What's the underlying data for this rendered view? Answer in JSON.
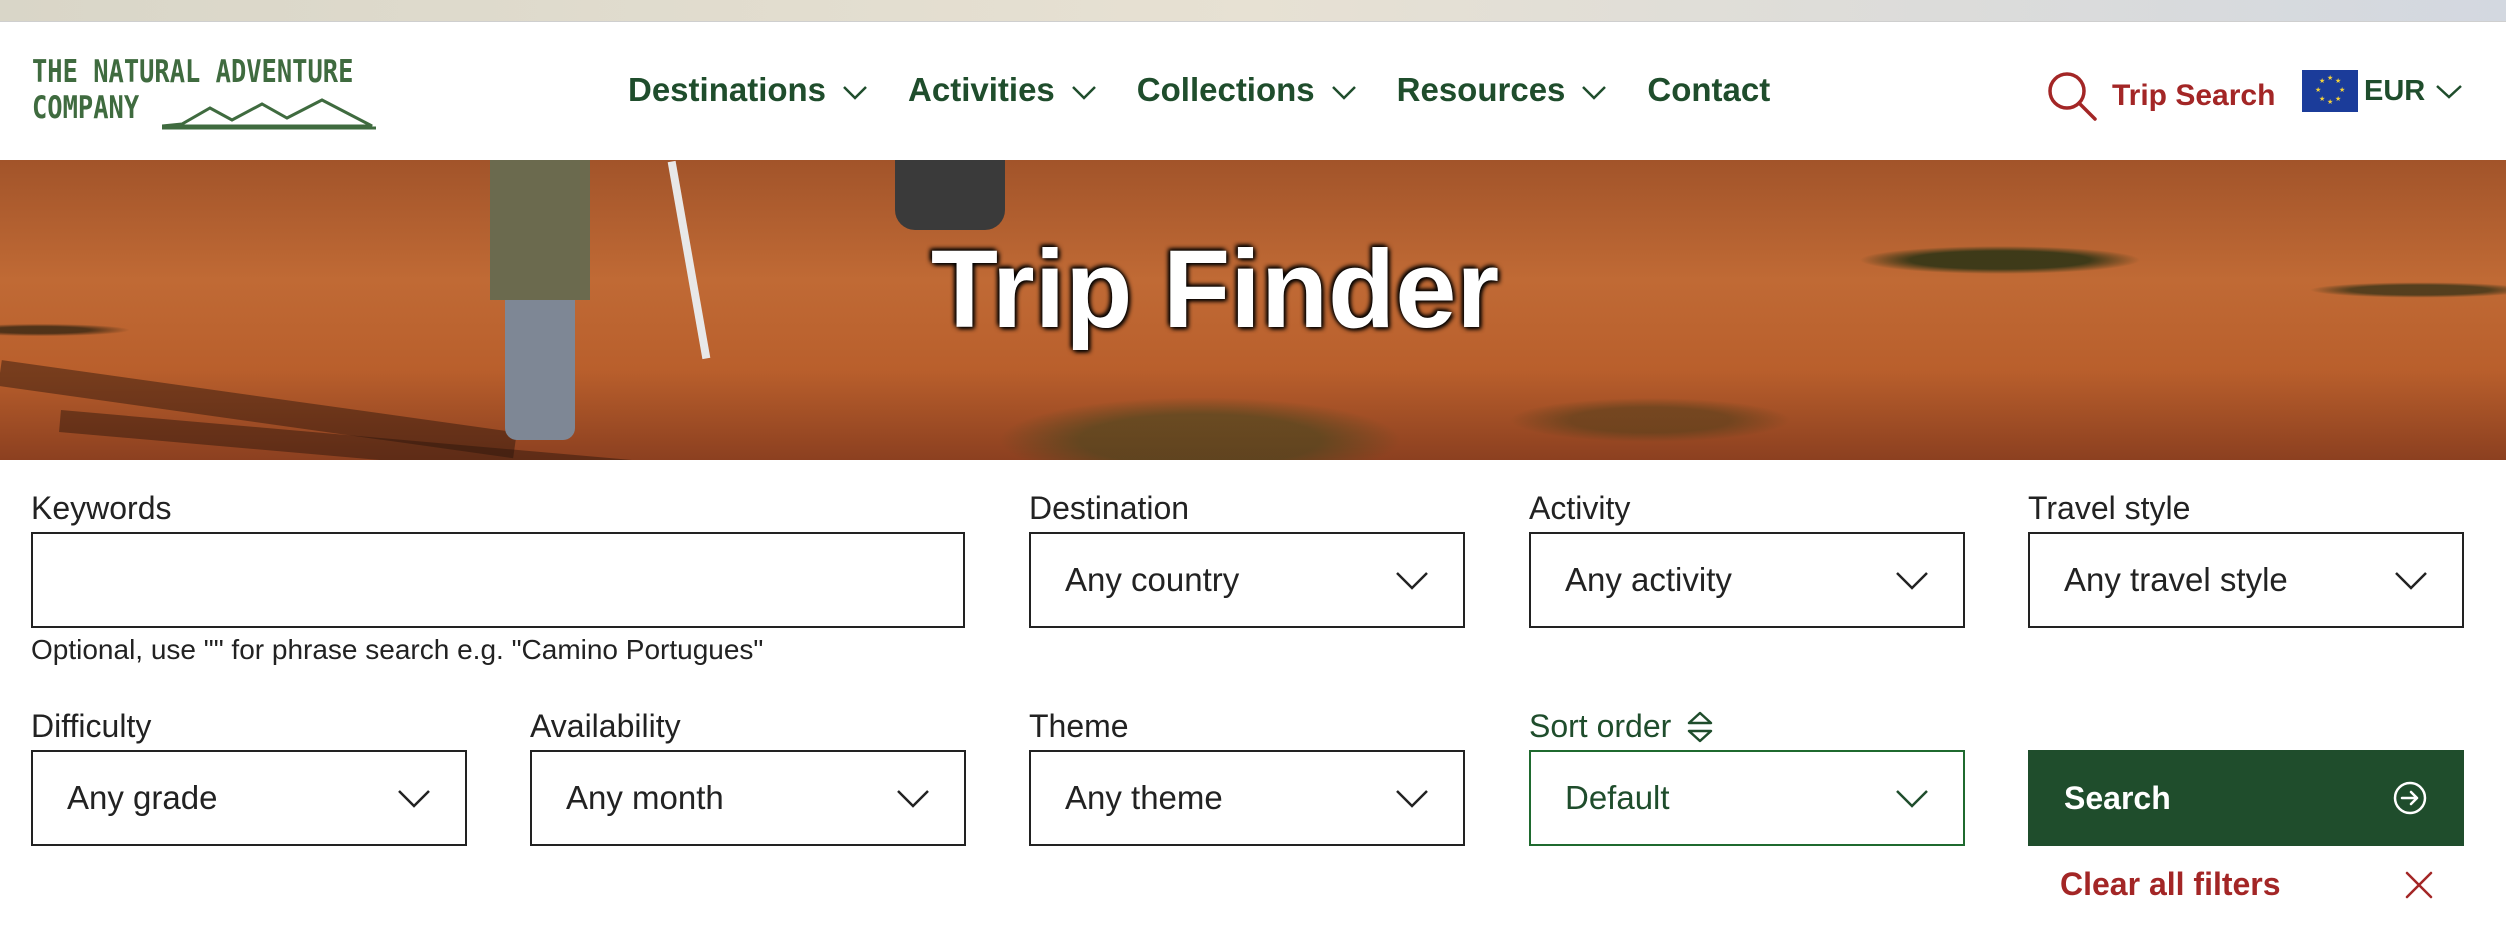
{
  "logo": {
    "line1": "THE NATURAL ADVENTURE",
    "line2": "COMPANY"
  },
  "nav": {
    "items": [
      {
        "label": "Destinations",
        "has_dropdown": true
      },
      {
        "label": "Activities",
        "has_dropdown": true
      },
      {
        "label": "Collections",
        "has_dropdown": true
      },
      {
        "label": "Resources",
        "has_dropdown": true
      },
      {
        "label": "Contact",
        "has_dropdown": false
      }
    ]
  },
  "trip_search": {
    "label": "Trip Search",
    "icon": "search-icon"
  },
  "currency": {
    "code": "EUR",
    "flag": "eu-flag-icon"
  },
  "hero": {
    "title": "Trip Finder"
  },
  "filters": {
    "keywords": {
      "label": "Keywords",
      "value": "",
      "hint": "Optional, use \"\" for phrase search e.g. \"Camino Portugues\""
    },
    "destination": {
      "label": "Destination",
      "value": "Any country"
    },
    "activity": {
      "label": "Activity",
      "value": "Any activity"
    },
    "travel_style": {
      "label": "Travel style",
      "value": "Any travel style"
    },
    "difficulty": {
      "label": "Difficulty",
      "value": "Any grade"
    },
    "availability": {
      "label": "Availability",
      "value": "Any month"
    },
    "theme": {
      "label": "Theme",
      "value": "Any theme"
    },
    "sort_order": {
      "label": "Sort order",
      "value": "Default"
    },
    "search_button": "Search",
    "clear_all": "Clear all filters"
  },
  "colors": {
    "brand_green": "#1f4d2c",
    "accent_red": "#a32626",
    "eu_blue": "#1b3c9a"
  }
}
